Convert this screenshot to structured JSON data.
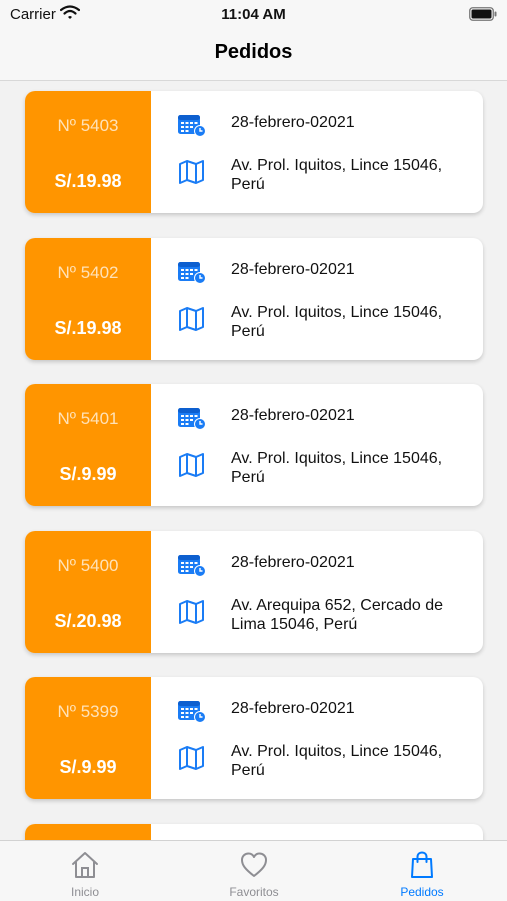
{
  "status_bar": {
    "carrier": "Carrier",
    "time": "11:04 AM"
  },
  "nav": {
    "title": "Pedidos"
  },
  "orders": [
    {
      "number": "Nº 5403",
      "price": "S/.19.98",
      "date": "28-febrero-02021",
      "address": "Av. Prol. Iquitos, Lince 15046, Perú"
    },
    {
      "number": "Nº 5402",
      "price": "S/.19.98",
      "date": "28-febrero-02021",
      "address": "Av. Prol. Iquitos, Lince 15046, Perú"
    },
    {
      "number": "Nº 5401",
      "price": "S/.9.99",
      "date": "28-febrero-02021",
      "address": "Av. Prol. Iquitos, Lince 15046, Perú"
    },
    {
      "number": "Nº 5400",
      "price": "S/.20.98",
      "date": "28-febrero-02021",
      "address": "Av. Arequipa 652, Cercado de Lima 15046, Perú"
    },
    {
      "number": "Nº 5399",
      "price": "S/.9.99",
      "date": "28-febrero-02021",
      "address": "Av. Prol. Iquitos, Lince 15046, Perú"
    }
  ],
  "tabs": [
    {
      "label": "Inicio",
      "icon": "house-icon",
      "active": false
    },
    {
      "label": "Favoritos",
      "icon": "heart-icon",
      "active": false
    },
    {
      "label": "Pedidos",
      "icon": "bag-icon",
      "active": true
    }
  ],
  "colors": {
    "accent": "#ff9500",
    "tab_active": "#007aff",
    "icon_blue": "#1a7cf5"
  }
}
